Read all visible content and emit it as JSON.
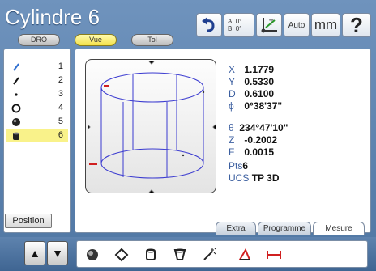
{
  "title": "Cylindre 6",
  "mode_buttons": [
    "DRO",
    "Vue",
    "Tol"
  ],
  "toolbar": {
    "auto_label": "Auto",
    "unit_label": "mm",
    "help_label": "?",
    "angle_a": "0°",
    "angle_b": "0°",
    "angle_a_letter": "A",
    "angle_b_letter": "B"
  },
  "features": [
    {
      "num": "1",
      "icon": "line-icon"
    },
    {
      "num": "2",
      "icon": "line-icon"
    },
    {
      "num": "3",
      "icon": "point-icon"
    },
    {
      "num": "4",
      "icon": "circle-icon"
    },
    {
      "num": "5",
      "icon": "sphere-icon"
    },
    {
      "num": "6",
      "icon": "cylinder-icon"
    }
  ],
  "position_label": "Position",
  "readouts": {
    "x_label": "X",
    "x": "1.1779",
    "y_label": "Y",
    "y": "0.5330",
    "d_label": "D",
    "d": "0.6100",
    "phi_label": "ϕ",
    "phi": "0°38'37\"",
    "theta_label": "θ",
    "theta": "234°47'10\"",
    "z_label": "Z",
    "z": "-0.2002",
    "f_label": "F",
    "f": "0.0015",
    "pts_label": "Pts",
    "pts": "6",
    "ucs_label": "UCS",
    "ucs": "TP",
    "ucs_mode": "3D"
  },
  "tabs": [
    "Extra",
    "Programme",
    "Mesure"
  ],
  "colors": {
    "accent": "#4f76a3",
    "selected": "#f9f28a",
    "cylinder": "#3a3ad0",
    "marker": "#d02020"
  }
}
